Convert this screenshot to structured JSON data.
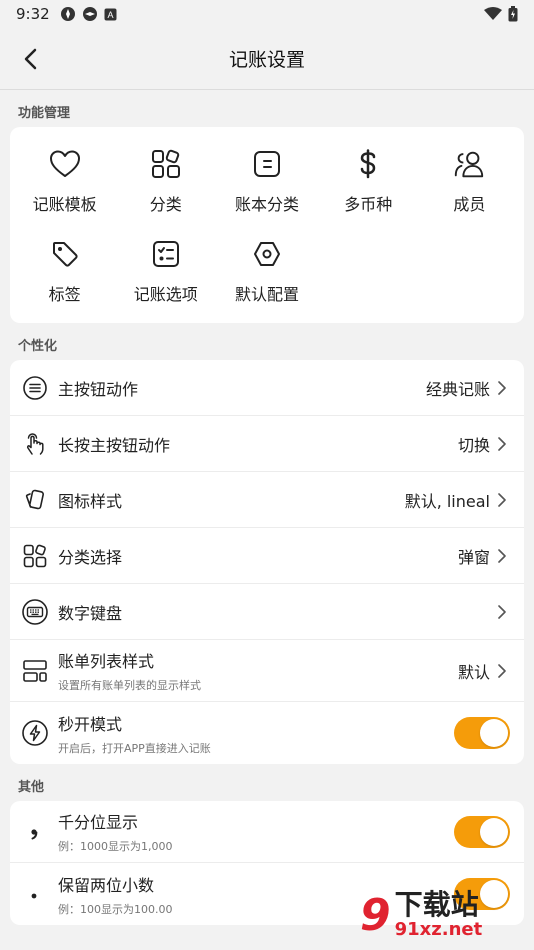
{
  "status": {
    "time": "9:32"
  },
  "header": {
    "title": "记账设置"
  },
  "sections": {
    "features": "功能管理",
    "personal": "个性化",
    "other": "其他"
  },
  "features": [
    {
      "label": "记账模板",
      "icon": "heart-icon"
    },
    {
      "label": "分类",
      "icon": "category-icon"
    },
    {
      "label": "账本分类",
      "icon": "ledger-icon"
    },
    {
      "label": "多币种",
      "icon": "dollar-icon"
    },
    {
      "label": "成员",
      "icon": "members-icon"
    },
    {
      "label": "标签",
      "icon": "tag-icon"
    },
    {
      "label": "记账选项",
      "icon": "checklist-icon"
    },
    {
      "label": "默认配置",
      "icon": "hexagon-settings-icon"
    }
  ],
  "personal": [
    {
      "label": "主按钮动作",
      "value": "经典记账",
      "icon": "list-circle-icon"
    },
    {
      "label": "长按主按钮动作",
      "value": "切换",
      "icon": "touch-icon"
    },
    {
      "label": "图标样式",
      "value": "默认, lineal",
      "icon": "cards-icon"
    },
    {
      "label": "分类选择",
      "value": "弹窗",
      "icon": "category-icon"
    },
    {
      "label": "数字键盘",
      "value": "",
      "icon": "keyboard-icon"
    },
    {
      "label": "账单列表样式",
      "sub": "设置所有账单列表的显示样式",
      "value": "默认",
      "icon": "layout-icon"
    },
    {
      "label": "秒开模式",
      "sub": "开启后，打开APP直接进入记账",
      "toggle": true,
      "icon": "lightning-icon"
    }
  ],
  "other": [
    {
      "label": "千分位显示",
      "sub": "例：1000显示为1,000",
      "toggle": true,
      "icon": "comma-icon"
    },
    {
      "label": "保留两位小数",
      "sub": "例：100显示为100.00",
      "toggle": true,
      "icon": "dot-icon"
    }
  ],
  "watermark": {
    "logo": "9",
    "title": "下载站",
    "site": "91xz.net"
  },
  "colors": {
    "accent": "#f59c0a",
    "background": "#f2f2f2"
  }
}
